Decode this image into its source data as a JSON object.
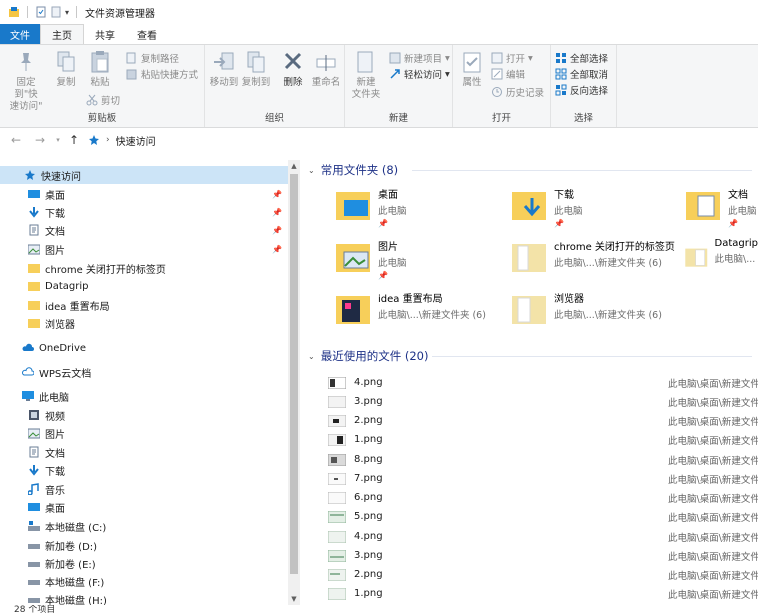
{
  "window": {
    "title": "文件资源管理器"
  },
  "menu_tabs": [
    "文件",
    "主页",
    "共享",
    "查看"
  ],
  "ribbon": {
    "clipboard": {
      "label": "剪贴板",
      "pin": "固定到\"快\n速访问\"",
      "copy": "复制",
      "paste": "粘贴",
      "copy_path": "复制路径",
      "paste_shortcut": "粘贴快捷方式",
      "cut": "剪切"
    },
    "organize": {
      "label": "组织",
      "move_to": "移动到",
      "copy_to": "复制到",
      "delete": "删除",
      "rename": "重命名"
    },
    "new": {
      "label": "新建",
      "new_folder": "新建\n文件夹",
      "new_item": "新建项目",
      "easy_access": "轻松访问"
    },
    "open": {
      "label": "打开",
      "properties": "属性",
      "open": "打开",
      "edit": "编辑",
      "history": "历史记录"
    },
    "select": {
      "label": "选择",
      "select_all": "全部选择",
      "select_none": "全部取消",
      "invert": "反向选择"
    }
  },
  "address": {
    "location": "快速访问"
  },
  "nav": {
    "quick_access": "快速访问",
    "items": [
      "桌面",
      "下载",
      "文档",
      "图片",
      "chrome 关闭打开的标签页",
      "Datagrip",
      "idea 重置布局",
      "浏览器"
    ],
    "onedrive": "OneDrive",
    "wps": "WPS云文档",
    "this_pc": "此电脑",
    "pc_items": [
      "视频",
      "图片",
      "文档",
      "下载",
      "音乐",
      "桌面",
      "本地磁盘 (C:)",
      "新加卷 (D:)",
      "新加卷 (E:)",
      "本地磁盘 (F:)",
      "本地磁盘 (H:)"
    ]
  },
  "frequent": {
    "title": "常用文件夹 (8)",
    "tiles": [
      {
        "name": "桌面",
        "sub": "此电脑"
      },
      {
        "name": "下载",
        "sub": "此电脑"
      },
      {
        "name": "文档",
        "sub": "此电脑"
      },
      {
        "name": "图片",
        "sub": "此电脑"
      },
      {
        "name": "chrome 关闭打开的标签页",
        "sub": "此电脑\\...\\新建文件夹 (6)"
      },
      {
        "name": "Datagrip",
        "sub": "此电脑\\..."
      },
      {
        "name": "idea 重置布局",
        "sub": "此电脑\\...\\新建文件夹 (6)"
      },
      {
        "name": "浏览器",
        "sub": "此电脑\\...\\新建文件夹 (6)"
      }
    ]
  },
  "recent": {
    "title": "最近使用的文件 (20)",
    "files": [
      {
        "name": "4.png",
        "path": "此电脑\\桌面\\新建文件"
      },
      {
        "name": "3.png",
        "path": "此电脑\\桌面\\新建文件"
      },
      {
        "name": "2.png",
        "path": "此电脑\\桌面\\新建文件"
      },
      {
        "name": "1.png",
        "path": "此电脑\\桌面\\新建文件"
      },
      {
        "name": "8.png",
        "path": "此电脑\\桌面\\新建文件"
      },
      {
        "name": "7.png",
        "path": "此电脑\\桌面\\新建文件"
      },
      {
        "name": "6.png",
        "path": "此电脑\\桌面\\新建文件"
      },
      {
        "name": "5.png",
        "path": "此电脑\\桌面\\新建文件"
      },
      {
        "name": "4.png",
        "path": "此电脑\\桌面\\新建文件"
      },
      {
        "name": "3.png",
        "path": "此电脑\\桌面\\新建文件"
      },
      {
        "name": "2.png",
        "path": "此电脑\\桌面\\新建文件"
      },
      {
        "name": "1.png",
        "path": "此电脑\\桌面\\新建文件"
      }
    ]
  },
  "status": {
    "count": "28 个项目"
  },
  "colors": {
    "accent": "#1979ca",
    "section": "#1e3287",
    "folder": "#f7cf5a",
    "selection": "#cce4f7"
  }
}
